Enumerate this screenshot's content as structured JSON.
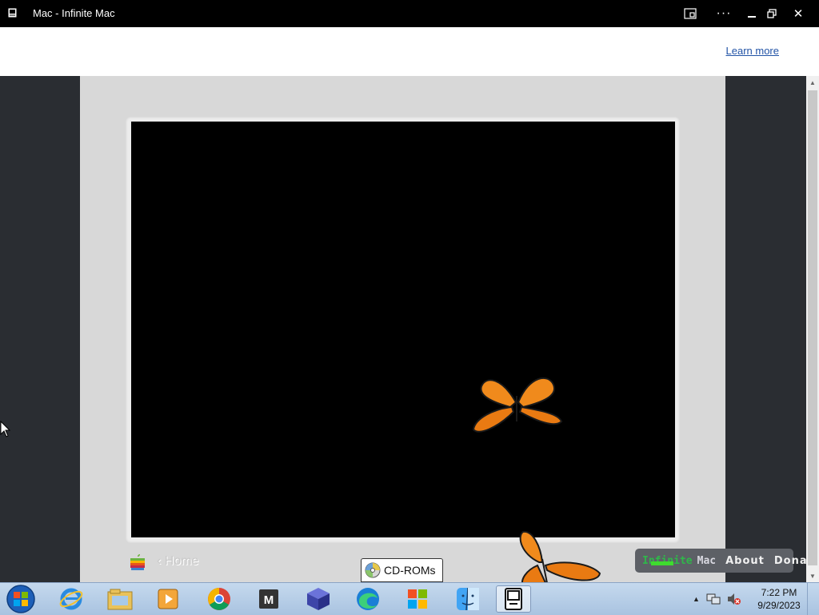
{
  "window": {
    "title": "Mac - Infinite Mac"
  },
  "banner": {
    "learn_more": "Learn more"
  },
  "monitor": {
    "home_link": "‹ Home",
    "cdrom_label": "CD-ROMs",
    "nav": {
      "brand_infinite": "Infinite",
      "brand_mac": "Mac",
      "about": "About",
      "donate": "Donate"
    }
  },
  "taskbar": {
    "apps": [
      "internet-explorer",
      "file-explorer",
      "media-player",
      "chrome",
      "m-app",
      "3d-box-app",
      "edge",
      "windows-store",
      "finder",
      "infinite-mac"
    ],
    "active_app": "infinite-mac",
    "clock_time": "7:22 PM",
    "clock_date": "9/29/2023"
  },
  "colors": {
    "titlebar": "#000000",
    "page_bg": "#2a2d32",
    "monitor_frame": "#d8d8d8",
    "screen": "#000000",
    "link": "#2153a6"
  }
}
